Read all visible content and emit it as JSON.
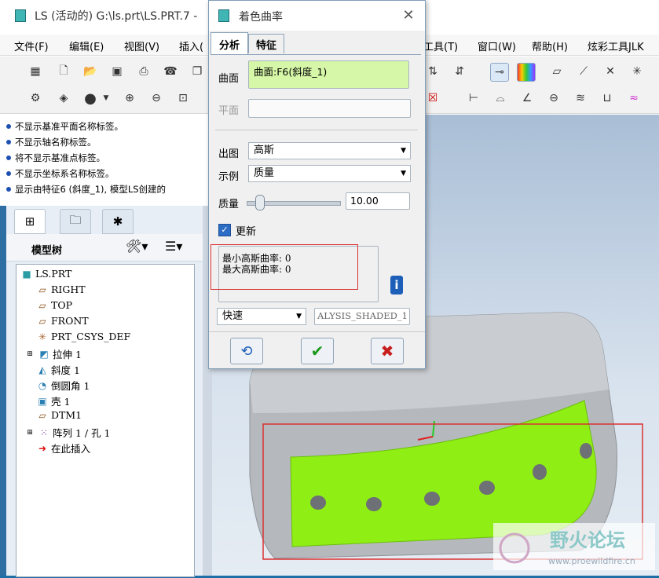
{
  "main_window": {
    "title": "LS (活动的) G:\\ls.prt\\LS.PRT.7 -",
    "menu": [
      "文件(F)",
      "编辑(E)",
      "视图(V)",
      "插入(",
      "工具(T)",
      "窗口(W)",
      "帮助(H)",
      "炫彩工具JLK"
    ]
  },
  "messages": [
    "不显示基准平面名称标签。",
    "不显示轴名称标签。",
    "将不显示基准点标签。",
    "不显示坐标系名称标签。",
    "显示由特征6 (斜度_1), 模型LS创建的"
  ],
  "model_tree": {
    "header": "模型树",
    "items": [
      {
        "label": "LS.PRT",
        "icon": "part-icon"
      },
      {
        "label": "RIGHT",
        "icon": "datum-plane-icon"
      },
      {
        "label": "TOP",
        "icon": "datum-plane-icon"
      },
      {
        "label": "FRONT",
        "icon": "datum-plane-icon"
      },
      {
        "label": "PRT_CSYS_DEF",
        "icon": "csys-icon"
      },
      {
        "label": "拉伸 1",
        "icon": "extrude-icon"
      },
      {
        "label": "斜度 1",
        "icon": "draft-icon"
      },
      {
        "label": "倒圆角 1",
        "icon": "round-icon"
      },
      {
        "label": "壳 1",
        "icon": "shell-icon"
      },
      {
        "label": "DTM1",
        "icon": "datum-plane-icon"
      },
      {
        "label": "阵列 1 / 孔 1",
        "icon": "pattern-icon"
      },
      {
        "label": "在此插入",
        "icon": "insert-arrow-icon"
      }
    ]
  },
  "dialog": {
    "title": "着色曲率",
    "tabs": [
      "分析",
      "特征"
    ],
    "surface_label": "曲面",
    "surface_value": "曲面:F6(斜度_1)",
    "plane_label": "平面",
    "output_label": "出图",
    "output_value": "高斯",
    "example_label": "示例",
    "example_value": "质量",
    "quality_label": "质量",
    "quality_value": "10.00",
    "quality_level": 0.1,
    "update_label": "更新",
    "update_checked": true,
    "result_min": "最小高斯曲率: 0",
    "result_max": "最大高斯曲率: 0",
    "mode_value": "快速",
    "name_value": "ALYSIS_SHADED_1"
  },
  "watermark": {
    "name": "野火论坛",
    "url": "www.proewildfire.cn"
  },
  "colors": {
    "highlight_green": "#8fef14",
    "annotation_red": "#d93232",
    "model_gray": "#b5b9bd"
  }
}
